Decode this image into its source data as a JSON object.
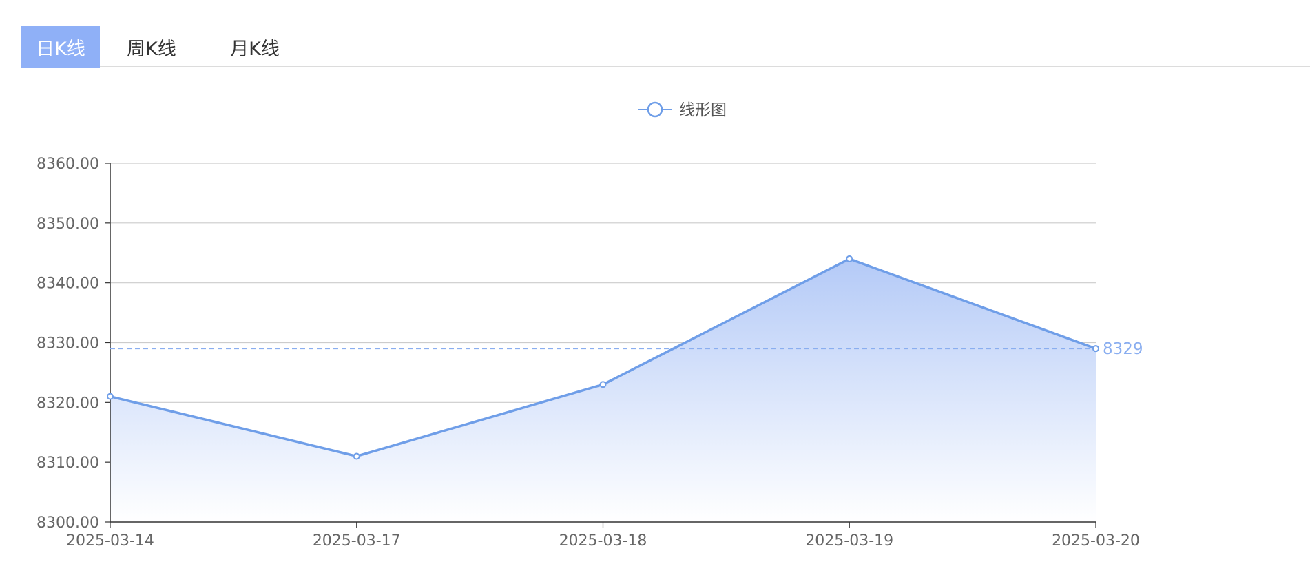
{
  "tabs": [
    {
      "label": "日K线",
      "active": true
    },
    {
      "label": "周K线",
      "active": false
    },
    {
      "label": "月K线",
      "active": false
    }
  ],
  "colors": {
    "accent": "#6f9ee8",
    "tab_active_bg": "#8fb0f7",
    "mark_line": "#8aaef0",
    "area_top": "#b4caf7",
    "area_bottom": "#ffffff"
  },
  "chart_data": {
    "type": "area",
    "categories": [
      "2025-03-14",
      "2025-03-17",
      "2025-03-18",
      "2025-03-19",
      "2025-03-20"
    ],
    "series": [
      {
        "name": "线形图",
        "values": [
          8321,
          8311,
          8323,
          8344,
          8329
        ]
      }
    ],
    "ylim": [
      8300,
      8360
    ],
    "yticks": [
      "8300.00",
      "8310.00",
      "8320.00",
      "8330.00",
      "8340.00",
      "8350.00",
      "8360.00"
    ],
    "grid": true,
    "legend": "top-center",
    "mark_line": {
      "value": 8329,
      "label": "8329"
    }
  }
}
